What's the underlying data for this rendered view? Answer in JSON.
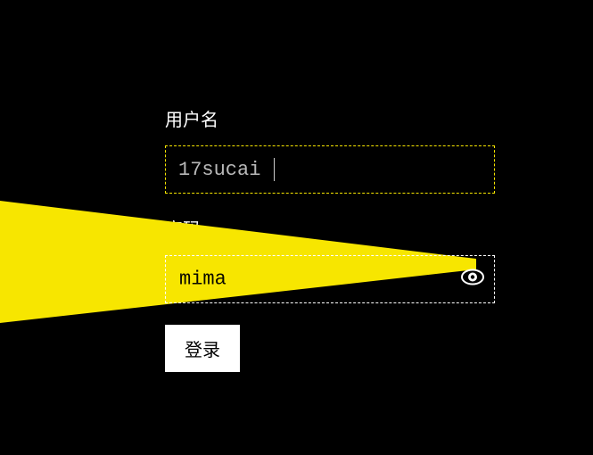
{
  "form": {
    "username_label": "用户名",
    "username_value": "17sucai",
    "password_label": "密码",
    "password_value": "mima",
    "login_label": "登录"
  },
  "colors": {
    "spotlight": "#f7e600",
    "background": "#000000",
    "input_border": "#ffffff",
    "active_border": "#f7e600"
  }
}
